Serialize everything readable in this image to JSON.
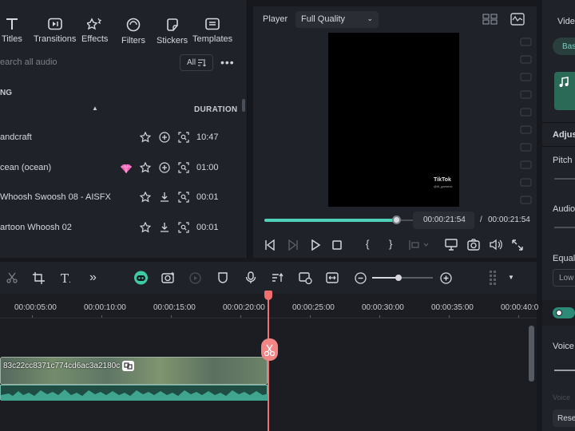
{
  "library": {
    "tabs": [
      {
        "label": "Titles",
        "icon": "titles-icon"
      },
      {
        "label": "Transitions",
        "icon": "transitions-icon"
      },
      {
        "label": "Effects",
        "icon": "effects-icon"
      },
      {
        "label": "Filters",
        "icon": "filters-icon"
      },
      {
        "label": "Stickers",
        "icon": "stickers-icon"
      },
      {
        "label": "Templates",
        "icon": "templates-icon"
      }
    ],
    "search_placeholder": "earch all audio",
    "filter_label": "All",
    "more": "•••",
    "section": "NG",
    "sort_arrow": "▲",
    "duration_header": "DURATION",
    "rows": [
      {
        "name": "andcraft",
        "duration": "10:47",
        "premium": false,
        "action": "add"
      },
      {
        "name": "cean (ocean)",
        "duration": "01:00",
        "premium": true,
        "action": "add"
      },
      {
        "name": "Whoosh Swoosh 08 - AISFX",
        "duration": "00:01",
        "premium": false,
        "action": "download"
      },
      {
        "name": "artoon Whoosh 02",
        "duration": "00:01",
        "premium": false,
        "action": "download"
      }
    ]
  },
  "player": {
    "label": "Player",
    "quality": "Full Quality",
    "watermark": "TikTok",
    "watermark_sub": "@ifi_gamerzi",
    "current_time": "00:00:21:54",
    "separator": "/",
    "total_time": "00:00:21:54",
    "progress": 1.0
  },
  "right_panel": {
    "tab": "Vide",
    "sub_tab": "Bas",
    "section": "Adjus",
    "pitch": "Pitch",
    "audio": "Audio",
    "equalizer": "Equali",
    "eq_value": "Low",
    "voice": "Voice",
    "voice2": "Voice",
    "reset": "Rese"
  },
  "timeline": {
    "ticks": [
      "00:00:05:00",
      "00:00:10:00",
      "00:00:15:00",
      "00:00:20:00",
      "00:00:25:00",
      "00:00:30:00",
      "00:00:35:00",
      "00:00:40:0"
    ],
    "clip_name": "83c22cc8371c774cd6ac3a2180c",
    "accent": "#4fd1b7",
    "playhead_color": "#f16f6f"
  }
}
